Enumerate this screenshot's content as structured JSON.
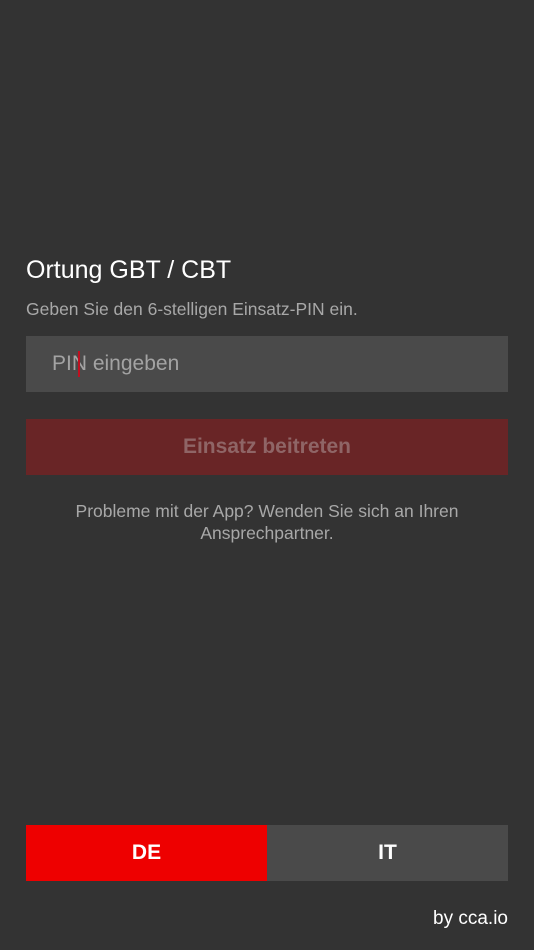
{
  "screen": {
    "title": "Ortung GBT / CBT",
    "subtitle": "Geben Sie den 6-stelligen Einsatz-PIN ein."
  },
  "pin_input": {
    "value": "",
    "placeholder": "PIN eingeben"
  },
  "join_button": {
    "label": "Einsatz beitreten"
  },
  "help": {
    "text": "Probleme mit der App? Wenden Sie sich an Ihren Ansprechpartner."
  },
  "language": {
    "options": [
      {
        "label": "DE",
        "selected": true
      },
      {
        "label": "IT",
        "selected": false
      }
    ]
  },
  "footer": {
    "credit": "by cca.io"
  },
  "colors": {
    "background": "#333333",
    "input_background": "#4a4a4a",
    "accent_red": "#ee0000",
    "button_disabled": "#692526"
  }
}
